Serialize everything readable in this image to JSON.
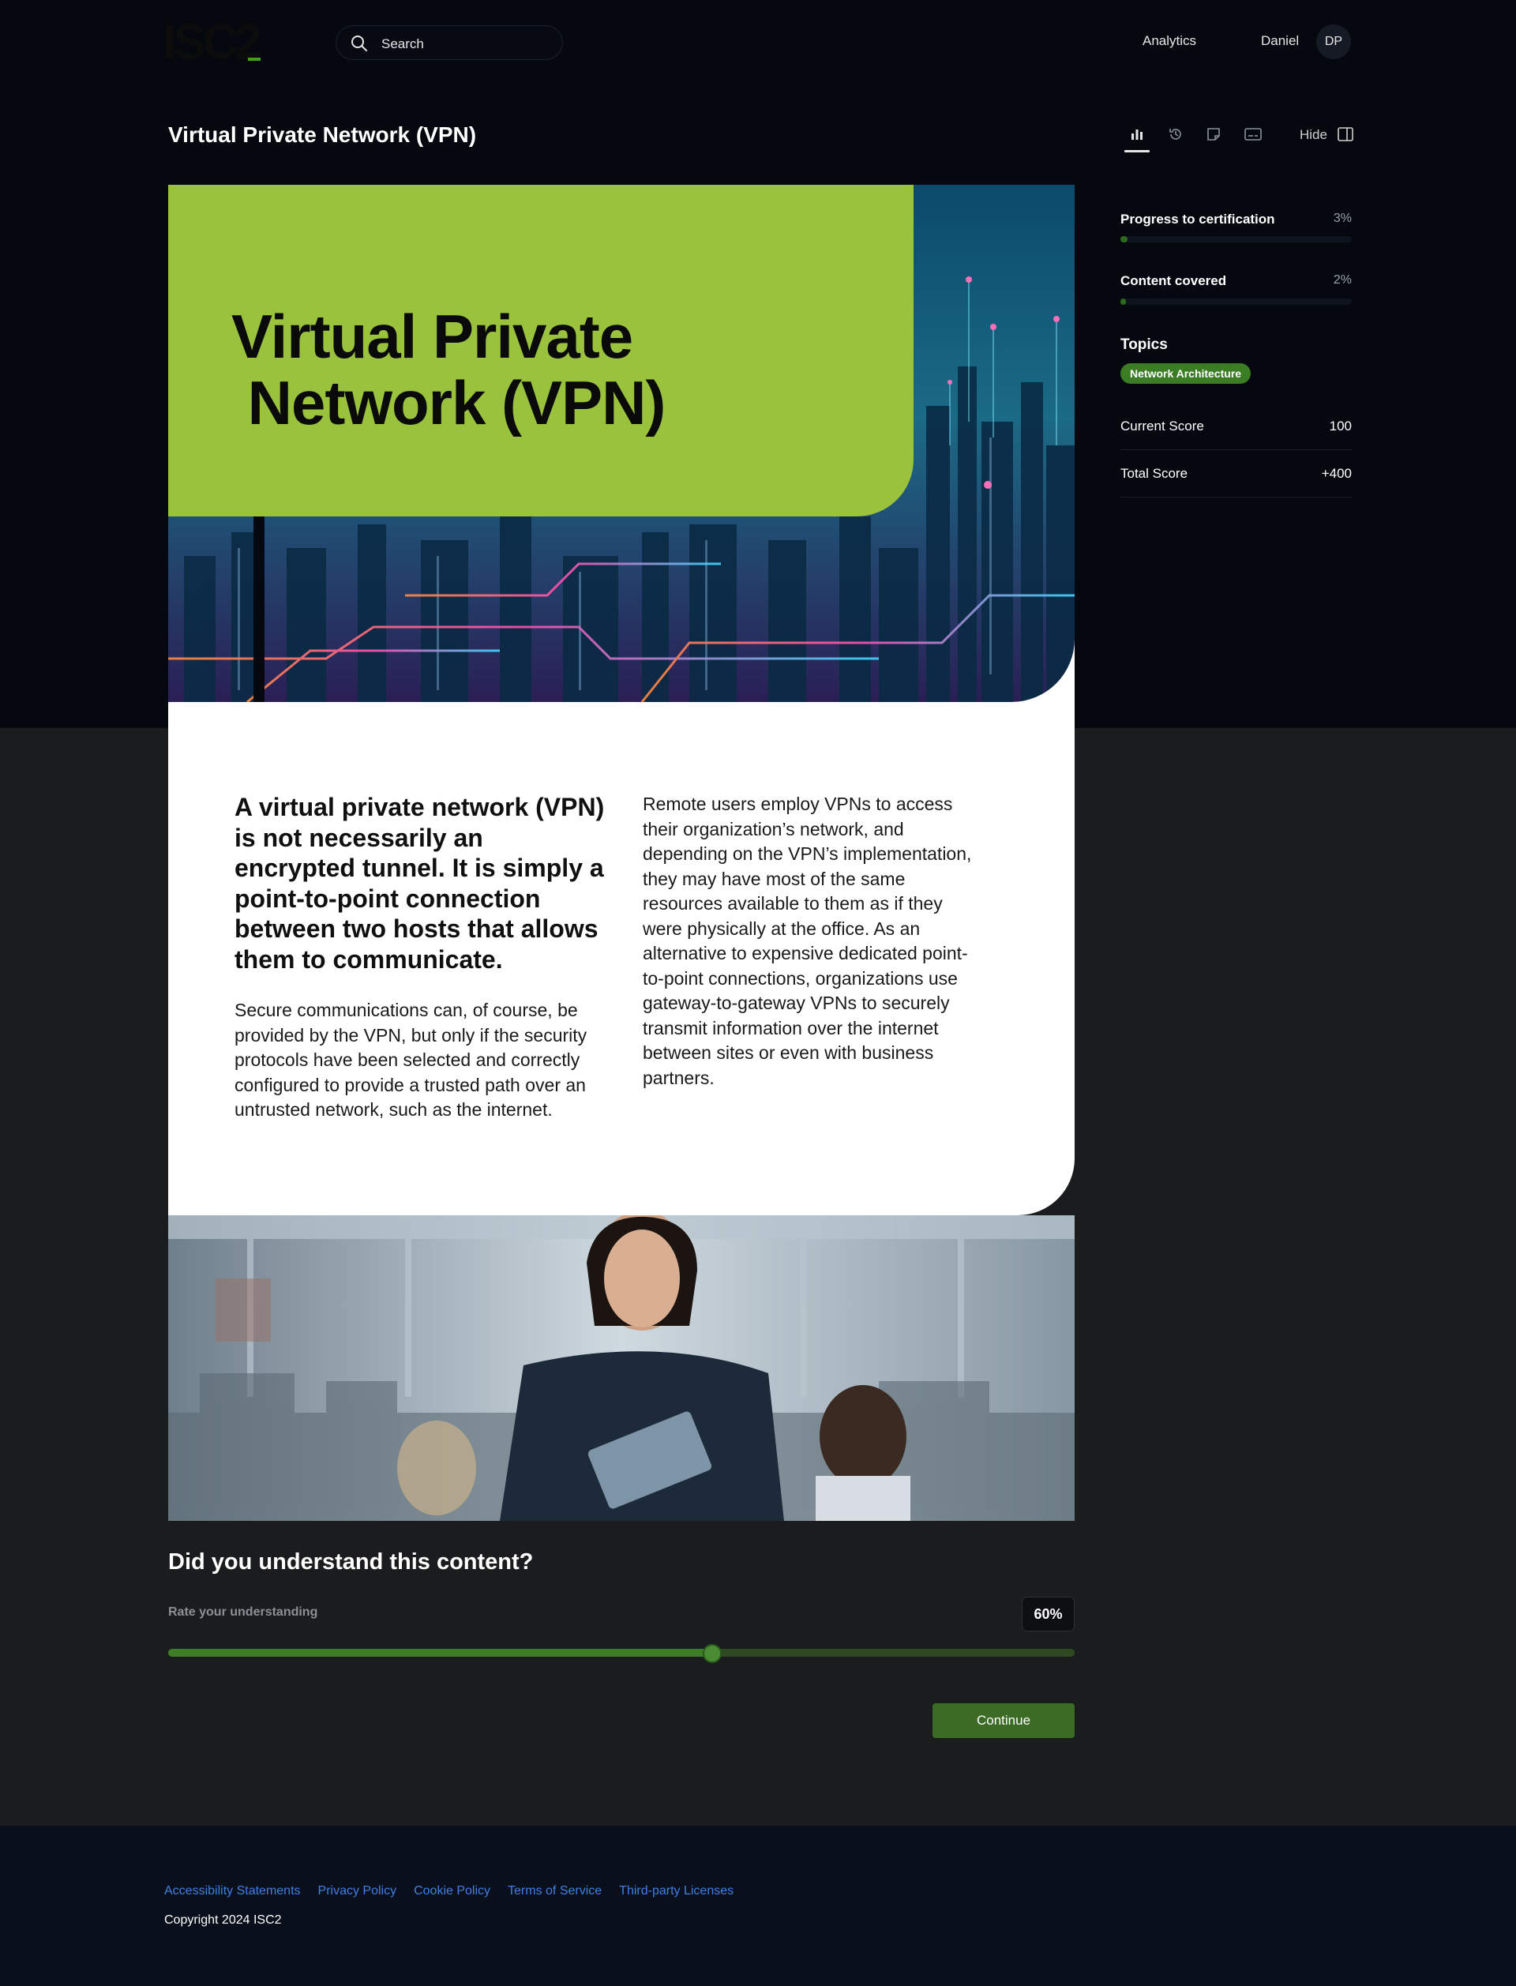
{
  "header": {
    "logo_text": "ISC2",
    "search_placeholder": "Search",
    "nav_analytics": "Analytics",
    "user_name": "Daniel",
    "user_initials": "DP"
  },
  "page": {
    "title": "Virtual Private Network (VPN)"
  },
  "toolbar": {
    "icons": [
      "bar-chart-icon",
      "history-icon",
      "note-icon",
      "captions-icon"
    ],
    "hide_label": "Hide"
  },
  "sidebar": {
    "progress": {
      "label": "Progress to certification",
      "value": "3%",
      "fraction": 0.03
    },
    "content": {
      "label": "Content covered",
      "value": "2%",
      "fraction": 0.02
    },
    "topics_label": "Topics",
    "topics": [
      "Network Architecture"
    ],
    "current_score": {
      "label": "Current Score",
      "value": "100"
    },
    "total_score": {
      "label": "Total Score",
      "value": "+400"
    }
  },
  "hero": {
    "line1": "Virtual Private",
    "line2": " Network (VPN)"
  },
  "content": {
    "lead": "A virtual private network (VPN) is not necessarily an encrypted tunnel. It is simply a point-to-point connection between two hosts that allows them to communicate.",
    "left_paragraph": "Secure communications can, of course, be provided by the VPN, but only if the security protocols have been selected and correctly configured to provide a trusted path over an untrusted network, such as the internet.",
    "right_paragraph": "Remote users employ VPNs to access their organization’s network, and depending on the VPN’s implementation, they may have most of the same resources available to them as if they were physically at the office. As an alternative to expensive dedicated point-to-point connections, organizations use gateway-to-gateway VPNs to securely transmit information over the internet between sites or even with business partners."
  },
  "understanding": {
    "title": "Did you understand this content?",
    "rate_label": "Rate your understanding",
    "percent_text": "60%",
    "value": 0.6,
    "continue_label": "Continue"
  },
  "footer": {
    "links": [
      "Accessibility Statements",
      "Privacy Policy",
      "Cookie Policy",
      "Terms of Service",
      "Third-party Licenses"
    ],
    "copyright": "Copyright 2024 ISC2"
  },
  "colors": {
    "accent_green": "#3b7d25",
    "hero_green": "#9bc23d",
    "link_blue": "#3f7fe6",
    "header_bg": "#05080f"
  }
}
